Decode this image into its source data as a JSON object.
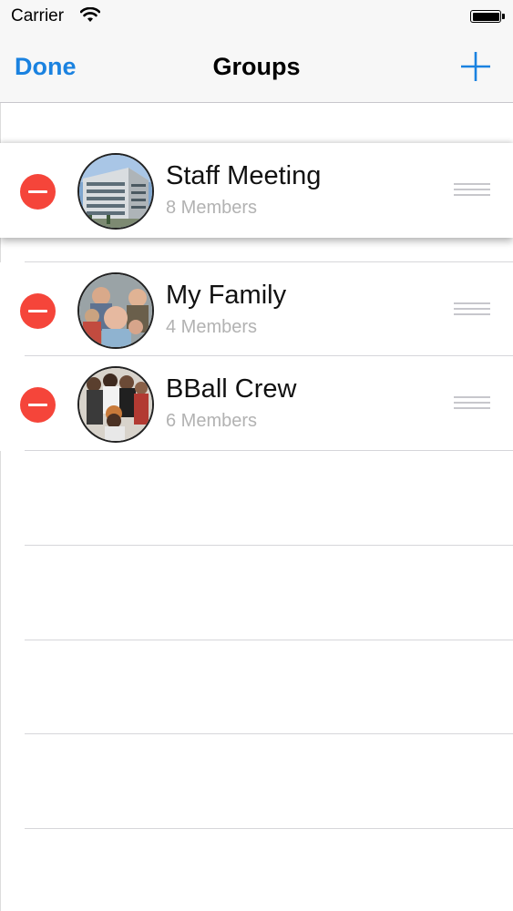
{
  "status_bar": {
    "carrier": "Carrier",
    "wifi_icon": "wifi-icon",
    "battery_icon": "battery-icon"
  },
  "nav": {
    "done_label": "Done",
    "title": "Groups",
    "add_icon": "plus-icon",
    "accent_color": "#1a82e0"
  },
  "groups": [
    {
      "name": "Staff Meeting",
      "members": "8 Members",
      "dragging": true
    },
    {
      "name": "My Family",
      "members": "4 Members",
      "dragging": false
    },
    {
      "name": "BBall Crew",
      "members": "6 Members",
      "dragging": false
    }
  ],
  "colors": {
    "delete_red": "#f5453a",
    "subtitle_gray": "#b2b2b2"
  }
}
